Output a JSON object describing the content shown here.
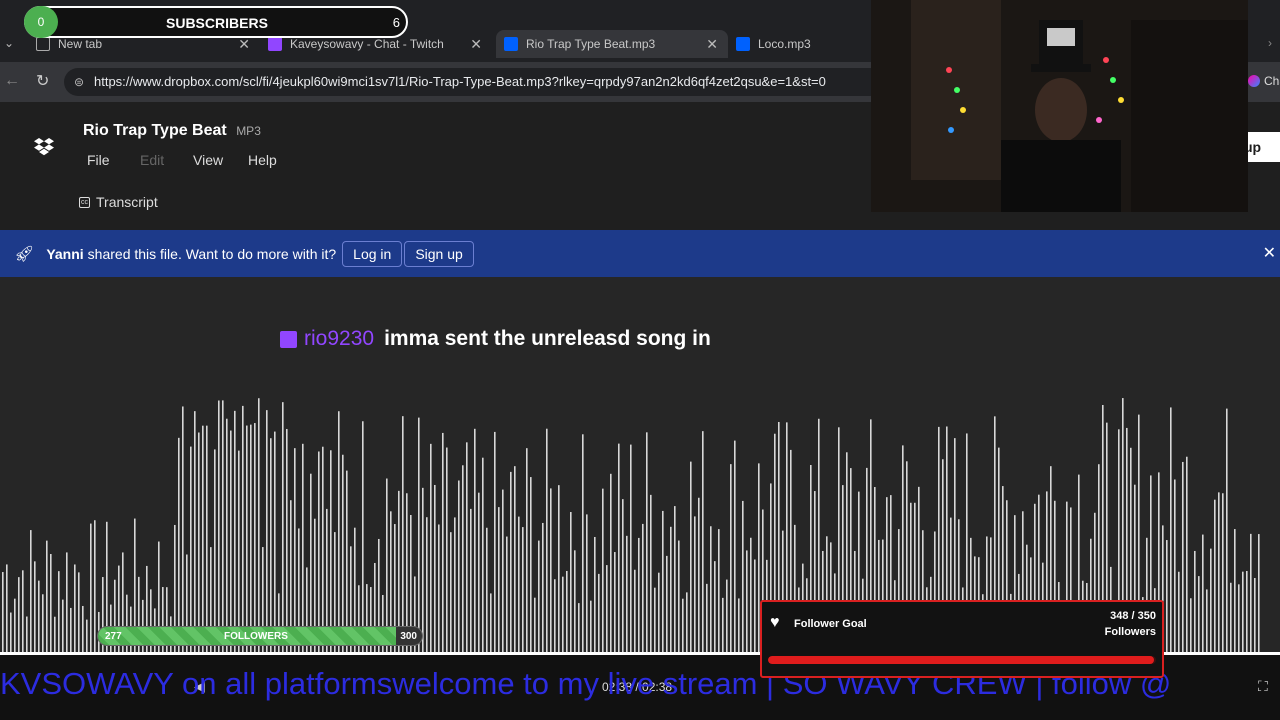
{
  "browser": {
    "tabs": [
      {
        "label": "New tab"
      },
      {
        "label": "Kaveysowavy - Chat - Twitch"
      },
      {
        "label": "Rio Trap Type Beat.mp3"
      },
      {
        "label": "Loco.mp3"
      }
    ],
    "url": "https://www.dropbox.com/scl/fi/4jeukpl60wi9mci1sv7l1/Rio-Trap-Type-Beat.mp3?rlkey=qrpdy97an2n2kd6qf4zet2qsu&e=1&st=0",
    "right_fragment": "Cha"
  },
  "file": {
    "name": "Rio Trap Type Beat",
    "ext": "MP3",
    "menu": [
      "File",
      "Edit",
      "View",
      "Help"
    ],
    "transcript": "Transcript",
    "signup_fragment": "up"
  },
  "banner": {
    "user": "Yanni",
    "text": "shared this file. Want to do more with it?",
    "login": "Log in",
    "signup": "Sign up"
  },
  "chat": {
    "username": "rio9230",
    "message": "imma sent the unreleasd song in"
  },
  "subscribers": {
    "label": "SUBSCRIBERS",
    "current": "0",
    "goal": "6"
  },
  "followers_bar": {
    "label": "FOLLOWERS",
    "current": "277",
    "goal": "300",
    "progress": 0.92
  },
  "follower_goal": {
    "title": "Follower Goal",
    "count": "348 / 350",
    "unit": "Followers",
    "progress": 0.994
  },
  "player": {
    "time": "02:38 / 02:38"
  },
  "ticker": "KVSOWAVY  on all platformswelcome to my live stream | SO WAVY CREW  | follow @",
  "colors": {
    "accent_blue": "#1d3a8a",
    "twitch_purple": "#9146ff",
    "goal_red": "#d92020",
    "progress_green": "#4caf50"
  }
}
